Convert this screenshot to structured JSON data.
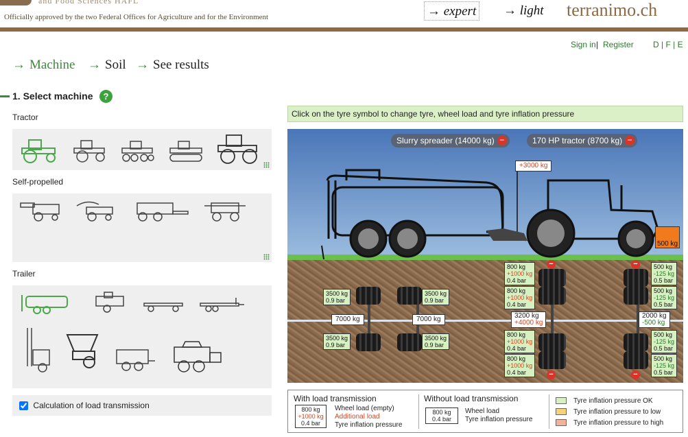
{
  "header": {
    "institution_fragment": "and Food Sciences HAFL",
    "approved": "Officially approved by the two Federal Offices for Agriculture and for the Environment",
    "mode_expert": "→ expert",
    "mode_light": "→ light",
    "brand": "terranimo.ch"
  },
  "account": {
    "signin": "Sign in",
    "separator": " | ",
    "register": "Register",
    "languages": "D | F | E"
  },
  "nav": {
    "machine": "Machine",
    "soil": "Soil",
    "results": "See results",
    "arrow": "→"
  },
  "section": {
    "title": "1. Select machine",
    "help": "?"
  },
  "categories": {
    "tractor": "Tractor",
    "self_propelled": "Self-propelled",
    "trailer": "Trailer"
  },
  "calc": {
    "label": "Calculation of load transmission",
    "checked": true
  },
  "instruction": "Click on the tyre symbol to change tyre, wheel load and tyre inflation pressure",
  "scene": {
    "machines": [
      {
        "label": "Slurry spreader (14000 kg)"
      },
      {
        "label": "170 HP tractor (8700 kg)"
      }
    ],
    "remove": "−",
    "hitch_load": "+3000 kg",
    "ballast": "500 kg",
    "spreader": {
      "front": {
        "load": "3500 kg",
        "pressure": "0.9 bar"
      },
      "rear": {
        "load": "3500 kg",
        "pressure": "0.9 bar"
      },
      "axle": "7000 kg"
    },
    "tractor_rear": {
      "load": "800 kg",
      "add": "+1000 kg",
      "pressure": "0.4 bar",
      "axle_load": "3200 kg",
      "axle_add": "+4000 kg"
    },
    "tractor_front": {
      "load": "500 kg",
      "sub": "-125 kg",
      "pressure": "0.5 bar",
      "axle_load": "2000 kg",
      "axle_sub": "-500 kg"
    }
  },
  "legend": {
    "with_title": "With load transmission",
    "without_title": "Without load transmission",
    "ex_load": "800 kg",
    "ex_add": "+1000 kg",
    "ex_pressure": "0.4 bar",
    "wheel_load_empty": "Wheel load (empty)",
    "additional_load": "Additional load",
    "tyre_pressure": "Tyre inflation pressure",
    "wheel_load": "Wheel load",
    "tyre_pressure2": "Tyre inflation pressure",
    "ok": "Tyre inflation pressure OK",
    "low": "Tyre inflation pressure to low",
    "high": "Tyre inflation pressure to high",
    "colors": {
      "ok": "#d6f0c2",
      "low": "#f6d27a",
      "high": "#f2b39a"
    }
  }
}
